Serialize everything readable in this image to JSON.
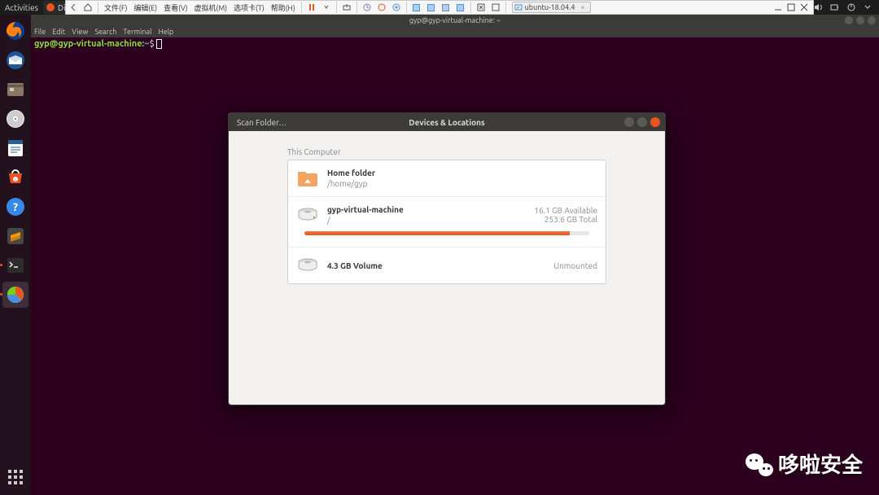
{
  "panel": {
    "activities": "Activities",
    "app_name": "Dis",
    "status_icons": [
      "network",
      "volume",
      "battery",
      "power",
      "caret"
    ]
  },
  "vm_toolbar": {
    "menus": [
      "文件(F)",
      "编辑(E)",
      "查看(V)",
      "虚拟机(M)",
      "选项卡(T)",
      "帮助(H)"
    ],
    "tab_label": "ubuntu-18.04.4"
  },
  "dock": {
    "items": [
      {
        "name": "firefox"
      },
      {
        "name": "thunderbird"
      },
      {
        "name": "files"
      },
      {
        "name": "rhythmbox"
      },
      {
        "name": "writer"
      },
      {
        "name": "software"
      },
      {
        "name": "help"
      },
      {
        "name": "sublime"
      },
      {
        "name": "terminal",
        "running": true
      },
      {
        "name": "disk-usage",
        "selected": true,
        "running": true
      }
    ]
  },
  "terminal": {
    "title": "gyp@gyp-virtual-machine: ~",
    "menu": [
      "File",
      "Edit",
      "View",
      "Search",
      "Terminal",
      "Help"
    ],
    "prompt_user": "gyp@gyp-virtual-machine",
    "prompt_sep": ":",
    "prompt_path": "~",
    "prompt_char": "$"
  },
  "dialog": {
    "scan_label": "Scan Folder…",
    "title": "Devices & Locations",
    "section": "This Computer",
    "items": [
      {
        "key": "home",
        "name": "Home folder",
        "sub": "/home/gyp"
      },
      {
        "key": "root",
        "name": "gyp-virtual-machine",
        "sub": "/",
        "avail": "16.1 GB Available",
        "total": "253.6 GB Total",
        "progress": 93
      },
      {
        "key": "vol",
        "name": "4.3 GB Volume",
        "status": "Unmounted"
      }
    ]
  },
  "watermark": {
    "text": "哆啦安全"
  }
}
